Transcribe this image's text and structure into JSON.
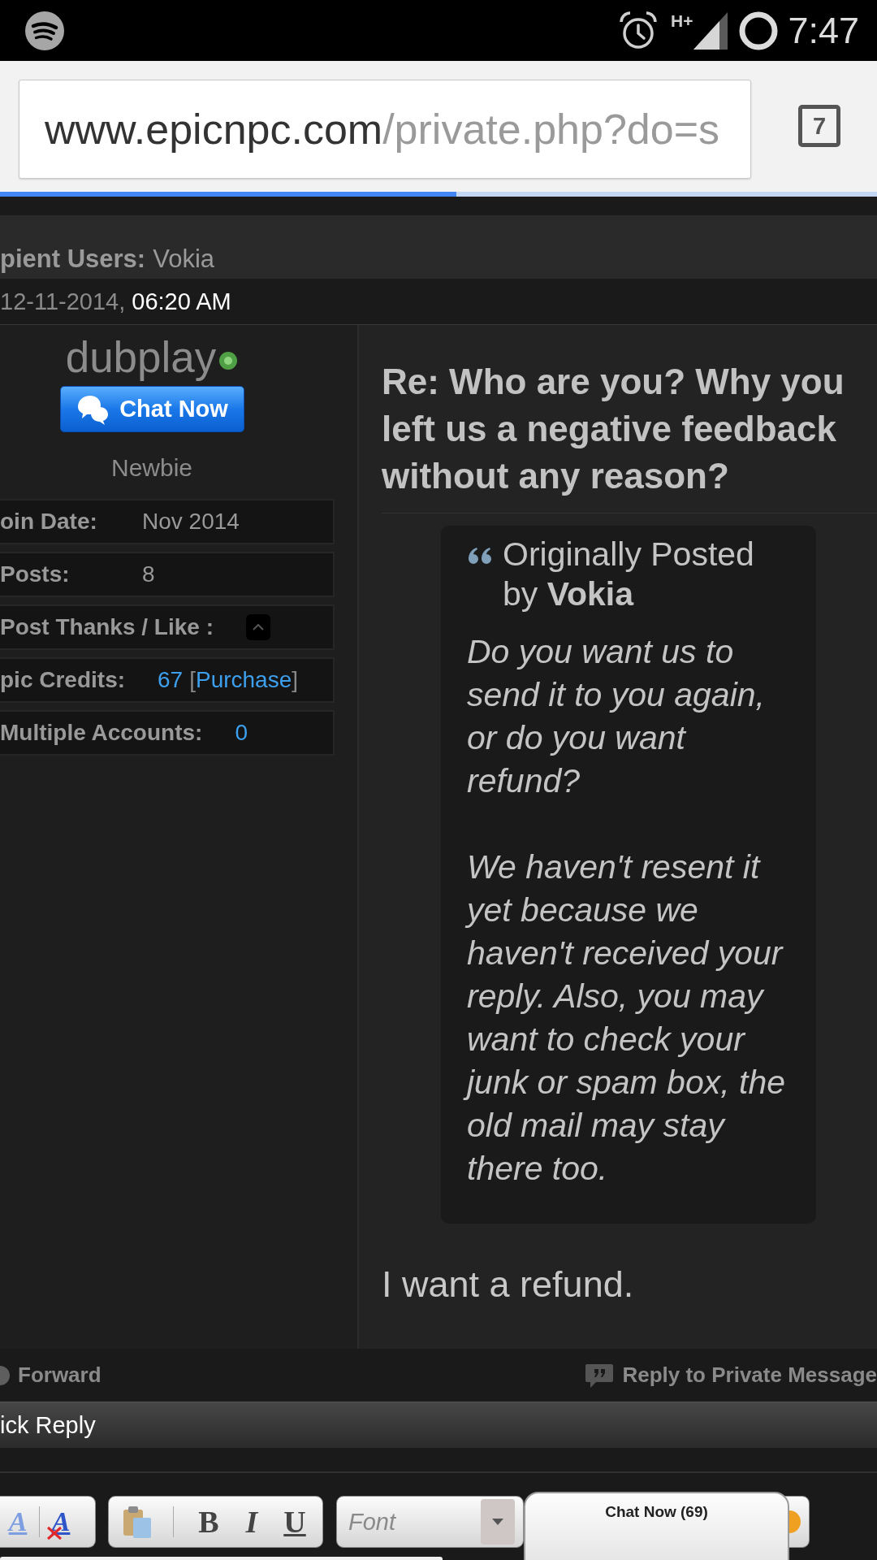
{
  "status_bar": {
    "network": "H+",
    "time": "7:47"
  },
  "browser": {
    "url_host": "www.epicnpc.com",
    "url_path": "/private.php?do=s",
    "tab_count": "7",
    "page_load": {
      "level": 0.52
    }
  },
  "message_header": {
    "recipients_label": "pient Users:",
    "recipients": "Vokia",
    "date": "12-11-2014,",
    "time": "06:20 AM"
  },
  "author": {
    "username": "dubplay",
    "online": true,
    "chat_button": "Chat Now",
    "rank": "Newbie",
    "stats": [
      {
        "kind": "text",
        "label": "oin Date:",
        "value": "Nov 2014"
      },
      {
        "kind": "text",
        "label": "Posts:",
        "value": "8"
      },
      {
        "kind": "thanks",
        "label": "Post Thanks / Like :"
      },
      {
        "kind": "credits",
        "label": "pic Credits:",
        "value": "67",
        "link": "Purchase",
        "brackets": [
          "[",
          "]"
        ]
      },
      {
        "kind": "link",
        "label": "Multiple Accounts:",
        "value": "0"
      }
    ]
  },
  "post": {
    "title": "Re: Who are you? Why you left us a negative feedback without any reason?",
    "quote": {
      "intro": "Originally Posted by **Vokia**",
      "paragraphs": [
        "Do you want us to send it to you again, or do you want refund?",
        "We haven't resent it yet because we haven't received your reply. Also, you may want to check your junk or spam box, the old mail may stay there too."
      ]
    },
    "body": "I want a refund."
  },
  "post_actions": [
    {
      "kind": "forward",
      "label": "Forward"
    },
    {
      "kind": "reply",
      "label": "Reply to Private Message"
    }
  ],
  "quick_reply": {
    "title": "ick Reply",
    "toolbar": [
      {
        "kind": "group",
        "tools": [
          {
            "kind": "font_color",
            "label": "A"
          },
          {
            "kind": "remove_format",
            "label": "A"
          }
        ]
      },
      {
        "kind": "group",
        "tools": [
          {
            "kind": "paste"
          },
          {
            "kind": "bold",
            "label": "B"
          },
          {
            "kind": "italic",
            "label": "I"
          },
          {
            "kind": "underline",
            "label": "U"
          }
        ]
      },
      {
        "kind": "dropdown",
        "label": "Font"
      },
      {
        "kind": "group",
        "tools": [
          {
            "kind": "emoji"
          }
        ]
      }
    ]
  },
  "chat_tab": {
    "label": "Chat Now (69)"
  }
}
